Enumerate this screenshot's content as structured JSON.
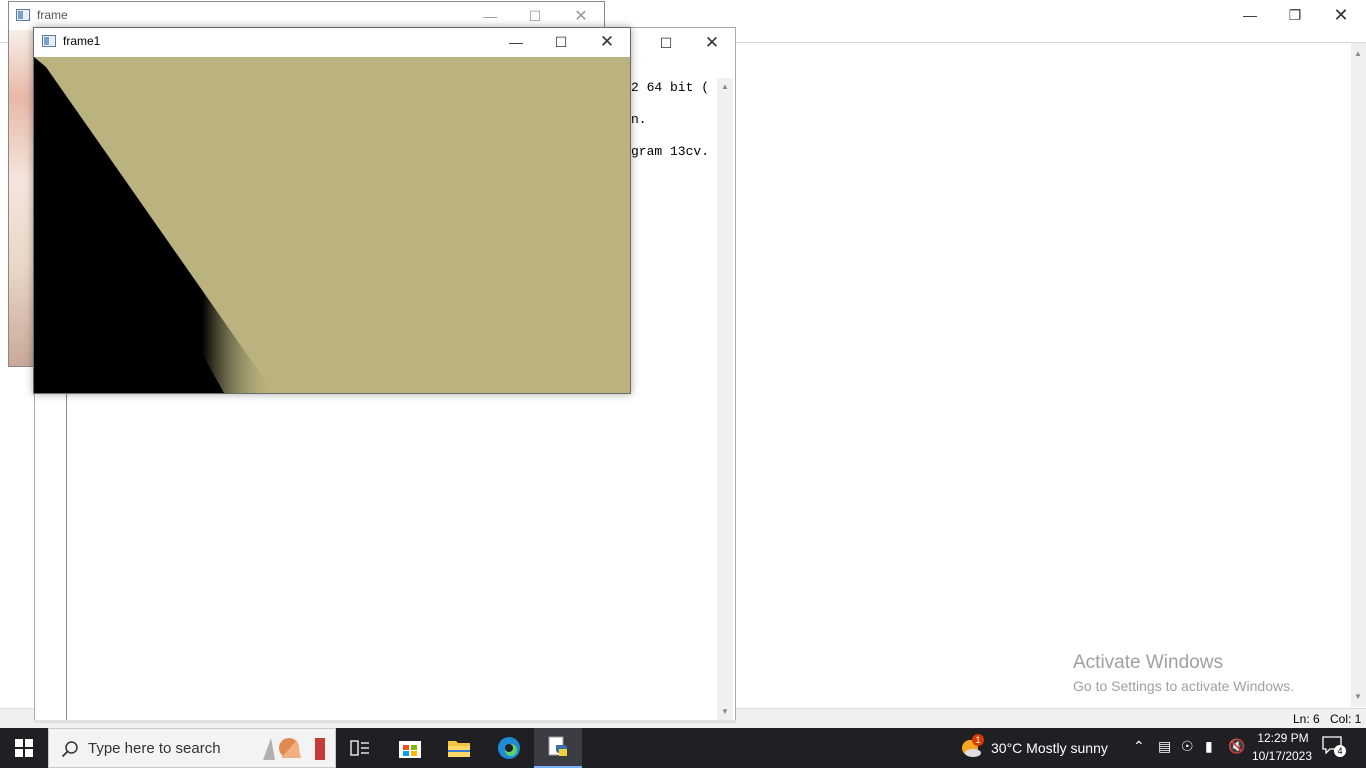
{
  "background_window": {
    "status": {
      "line": "Ln: 6",
      "col": "Col: 1"
    }
  },
  "shell": {
    "lines": [
      "2 64 bit (",
      "n.",
      "gram 13cv."
    ]
  },
  "frame_window": {
    "title": "frame"
  },
  "frame1_window": {
    "title": "frame1"
  },
  "activation": {
    "title": "Activate Windows",
    "subtitle": "Go to Settings to activate Windows."
  },
  "taskbar": {
    "search_placeholder": "Type here to search",
    "weather": "30°C  Mostly sunny",
    "weather_badge": "1",
    "time": "12:29 PM",
    "date": "10/17/2023",
    "notification_count": "4"
  },
  "colors": {
    "canvas": "#bab37f",
    "taskbar": "#1f1f24"
  },
  "icons": [
    "windows-start-icon",
    "search-icon",
    "task-view-icon",
    "store-icon",
    "file-explorer-icon",
    "edge-icon",
    "python-idle-icon",
    "weather-icon",
    "chevron-up-icon",
    "meet-icon",
    "network-icon",
    "battery-icon",
    "volume-mute-icon",
    "notification-icon"
  ]
}
